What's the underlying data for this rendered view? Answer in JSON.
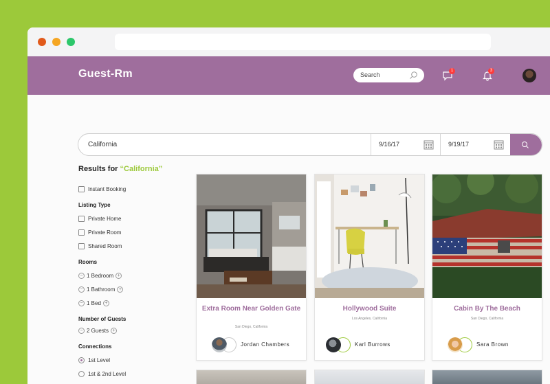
{
  "header": {
    "logo": "Guest-Rm",
    "search_placeholder": "Search",
    "chat_badge": "1",
    "bell_badge": "3"
  },
  "search": {
    "location": "California",
    "check_in": "9/16/17",
    "check_out": "9/19/17"
  },
  "filters": {
    "results_prefix": "Results for ",
    "results_query": "“California”",
    "instant_booking": "Instant Booking",
    "listing_type_title": "Listing Type",
    "listing_types": [
      "Private Home",
      "Private Room",
      "Shared Room"
    ],
    "rooms_title": "Rooms",
    "rooms": [
      "1 Bedroom",
      "1 Bathroom",
      "1 Bed"
    ],
    "guests_title": "Number of Guests",
    "guests": "2 Guests",
    "connections_title": "Connections",
    "connections": [
      "1st Level",
      "1st & 2nd Level"
    ]
  },
  "listings": [
    {
      "title": "Extra Room Near Golden Gate",
      "location": "San Diego, California",
      "host": "Jordan Chambers"
    },
    {
      "title": "Hollywood Suite",
      "location": "Los Angeles, California",
      "host": "Karl Burrows"
    },
    {
      "title": "Cabin By The Beach",
      "location": "San Diego, California",
      "host": "Sara Brown"
    }
  ],
  "colors": {
    "primary": "#9f6e9d",
    "accent": "#9cc93a"
  }
}
